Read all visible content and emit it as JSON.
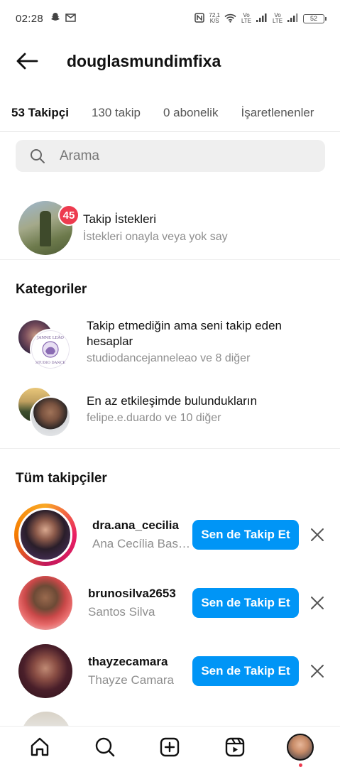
{
  "status_bar": {
    "time": "02:28",
    "network_speed": "72,1",
    "network_unit": "K/S",
    "volte_1": "Vo LTE",
    "volte_2": "Vo LTE",
    "battery": "52"
  },
  "header": {
    "username": "douglasmundimfixa"
  },
  "tabs": [
    {
      "label": "53 Takipçi",
      "active": true
    },
    {
      "label": "130 takip",
      "active": false
    },
    {
      "label": "0 abonelik",
      "active": false
    },
    {
      "label": "İşaretlenenler",
      "active": false
    }
  ],
  "search": {
    "placeholder": "Arama"
  },
  "requests": {
    "title": "Takip İstekleri",
    "subtitle": "İstekleri onayla veya yok say",
    "badge_count": "45"
  },
  "categories": {
    "heading": "Kategoriler",
    "items": [
      {
        "title": "Takip etmediğin ama seni takip eden hesaplar",
        "subtitle": "studiodancejanneleao ve 8 diğer",
        "avatar_text_top": "JANNE LEÃO",
        "avatar_text_bottom": "STUDIO DANCE"
      },
      {
        "title": "En az etkileşimde bulundukların",
        "subtitle": "felipe.e.duardo ve 10 diğer"
      }
    ]
  },
  "followers": {
    "heading": "Tüm takipçiler",
    "follow_label": "Sen de Takip Et",
    "items": [
      {
        "username": "dra.ana_cecilia",
        "name": "Ana Cecília Bastos",
        "has_story": true
      },
      {
        "username": "brunosilva2653",
        "name": "Santos Silva",
        "has_story": false
      },
      {
        "username": "thayzecamara",
        "name": "Thayze Camara",
        "has_story": false
      }
    ]
  },
  "bottom_nav": [
    {
      "icon": "home-icon"
    },
    {
      "icon": "search-icon"
    },
    {
      "icon": "create-icon"
    },
    {
      "icon": "reels-icon"
    },
    {
      "icon": "profile-avatar"
    }
  ]
}
